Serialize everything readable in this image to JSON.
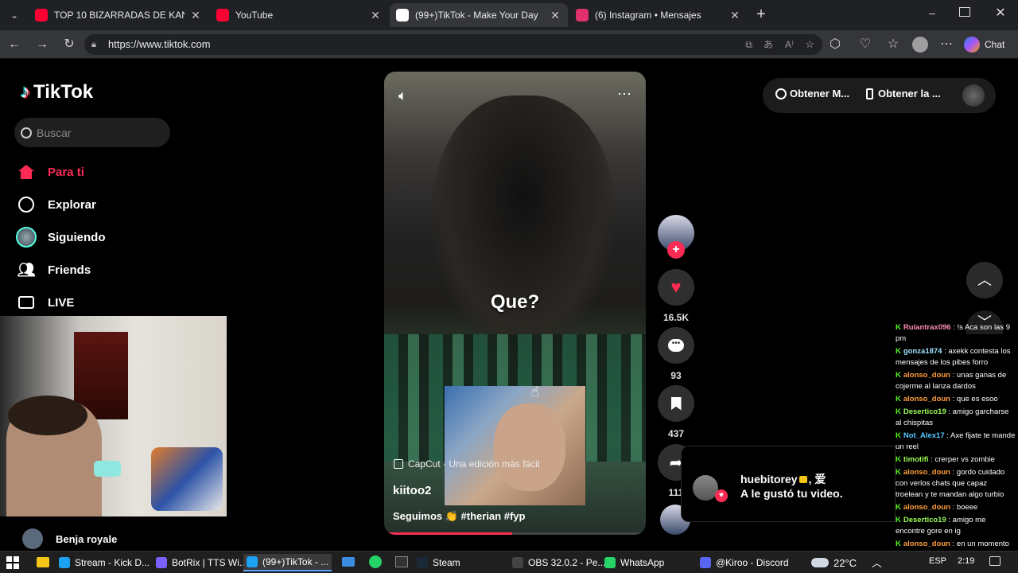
{
  "tabs": [
    {
      "title": "TOP 10 BIZARRADAS DE KANYE W",
      "color": "#ff0033"
    },
    {
      "title": "YouTube",
      "color": "#ff0033"
    },
    {
      "title": "(99+)TikTok - Make Your Day",
      "color": "#ffffff"
    },
    {
      "title": "(6) Instagram • Mensajes",
      "color": "#e1306c"
    }
  ],
  "address": {
    "url": "https://www.tiktok.com",
    "chat_label": "Chat"
  },
  "tiktok": {
    "logo": "TikTok",
    "search_placeholder": "Buscar",
    "nav": [
      {
        "label": "Para ti",
        "icon": "home-icon",
        "active": true
      },
      {
        "label": "Explorar",
        "icon": "compass-icon"
      },
      {
        "label": "Siguiendo",
        "icon": "following-avatar"
      },
      {
        "label": "Friends",
        "icon": "friends-icon"
      },
      {
        "label": "LIVE",
        "icon": "live-icon"
      }
    ],
    "suggested_account": "Benja royale",
    "top_right": {
      "get_coins": "Obtener M...",
      "get_app": "Obtener la ..."
    },
    "video": {
      "caption_overlay": "Que?",
      "capcut_label": "CapCut · Una edición más fácil",
      "author": "kiitoo2",
      "description": "Seguimos 👏 #therian #fyp",
      "progress": 0.49
    },
    "actions": {
      "likes": "16.5K",
      "comments": "93",
      "saves": "437",
      "shares": "111"
    },
    "notification": {
      "user": "huebitorey",
      "suffix": ", 爱",
      "message": "A le gustó tu video."
    }
  },
  "stream_chat": [
    {
      "user": "Rulantrax096",
      "text": "!s Aca son las 9 pm",
      "color": "#ff8fb0"
    },
    {
      "user": "gonza1874",
      "text": "axekk contesta los mensajes de los pibes forro",
      "color": "#a0e0ff"
    },
    {
      "user": "alonso_doun",
      "text": "unas ganas de cojerme al lanza dardos",
      "color": "#ff9e3d"
    },
    {
      "user": "alonso_doun",
      "text": "que es esoo",
      "color": "#ff9e3d"
    },
    {
      "user": "Desertico19",
      "text": "amigo garcharse al chispitas",
      "color": "#9cff57"
    },
    {
      "user": "Not_Alex17",
      "text": "Axe fijate te mande un reel",
      "color": "#55c8ff"
    },
    {
      "user": "timotifi",
      "text": "crerper vs zombie",
      "color": "#9cff57"
    },
    {
      "user": "alonso_doun",
      "text": "gordo cuidado con verlos chats que capaz troelean y te mandan algo turbio",
      "color": "#ff9e3d"
    },
    {
      "user": "alonso_doun",
      "text": "boeee",
      "color": "#ff9e3d"
    },
    {
      "user": "Desertico19",
      "text": "amigo me encontre gore en ig",
      "color": "#9cff57"
    },
    {
      "user": "alonso_doun",
      "text": "en un momento ig estaba turbio",
      "color": "#ff9e3d"
    }
  ],
  "taskbar": {
    "items": [
      {
        "label": "Stream - Kick D...",
        "color": "#1da1f2"
      },
      {
        "label": "BotRix | TTS Wi...",
        "color": "#7b61ff"
      },
      {
        "label": "(99+)TikTok - ...",
        "color": "#1da1f2"
      },
      {
        "label": "Steam",
        "color": "#1b2838"
      },
      {
        "label": "OBS 32.0.2 - Pe...",
        "color": "#444444"
      },
      {
        "label": "WhatsApp",
        "color": "#25d366"
      },
      {
        "label": "@Kiroo - Discord",
        "color": "#5865f2"
      }
    ],
    "weather": "22°C",
    "lang": "ESP",
    "time": "2:19"
  }
}
